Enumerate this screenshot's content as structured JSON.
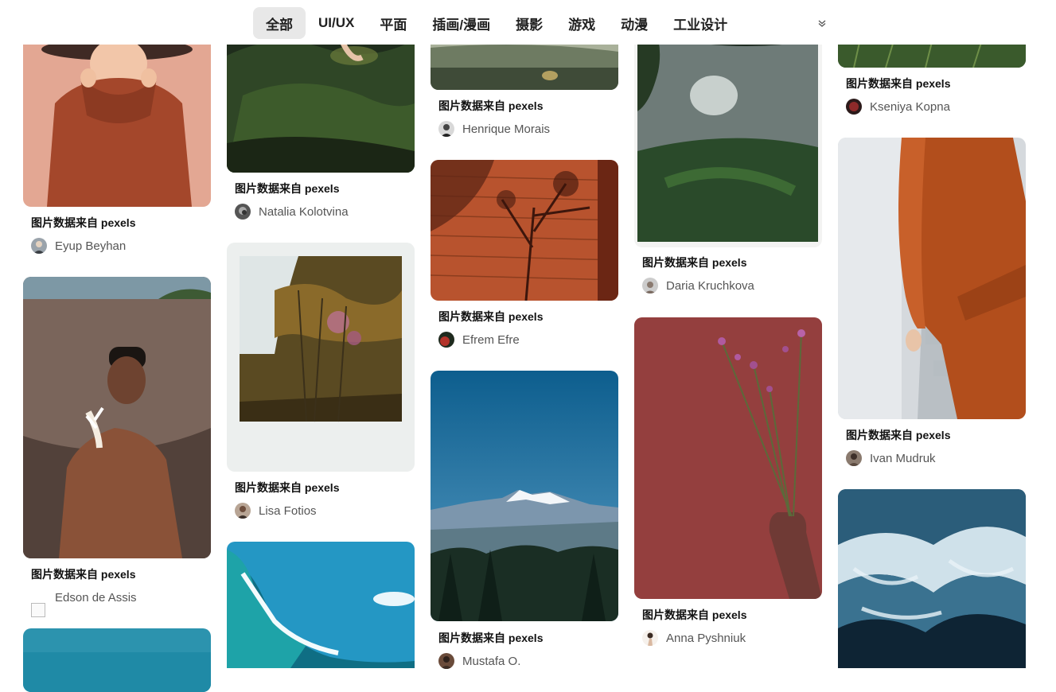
{
  "nav": {
    "tabs": [
      {
        "label": "全部",
        "active": true
      },
      {
        "label": "UI/UX"
      },
      {
        "label": "平面"
      },
      {
        "label": "插画/漫画"
      },
      {
        "label": "摄影"
      },
      {
        "label": "游戏"
      },
      {
        "label": "动漫"
      },
      {
        "label": "工业设计"
      }
    ],
    "more_icon": "chevron-double-down-icon"
  },
  "cards": [
    {
      "title": "图片数据来自 pexels",
      "author": "Eyup Beyhan"
    },
    {
      "title": "图片数据来自 pexels",
      "author": "Edson de Assis"
    },
    {
      "title": "图片数据来自 pexels",
      "author": "Natalia Kolotvina"
    },
    {
      "title": "图片数据来自 pexels",
      "author": "Lisa Fotios"
    },
    {
      "title": "图片数据来自 pexels",
      "author": "Henrique Morais"
    },
    {
      "title": "图片数据来自 pexels",
      "author": "Efrem Efre"
    },
    {
      "title": "图片数据来自 pexels",
      "author": "Mustafa O."
    },
    {
      "title": "图片数据来自 pexels",
      "author": "Daria Kruchkova"
    },
    {
      "title": "图片数据来自 pexels",
      "author": "Anna Pyshniuk"
    },
    {
      "title": "图片数据来自 pexels",
      "author": "Kseniya Kopna"
    },
    {
      "title": "图片数据来自 pexels",
      "author": "Ivan Mudruk"
    }
  ]
}
